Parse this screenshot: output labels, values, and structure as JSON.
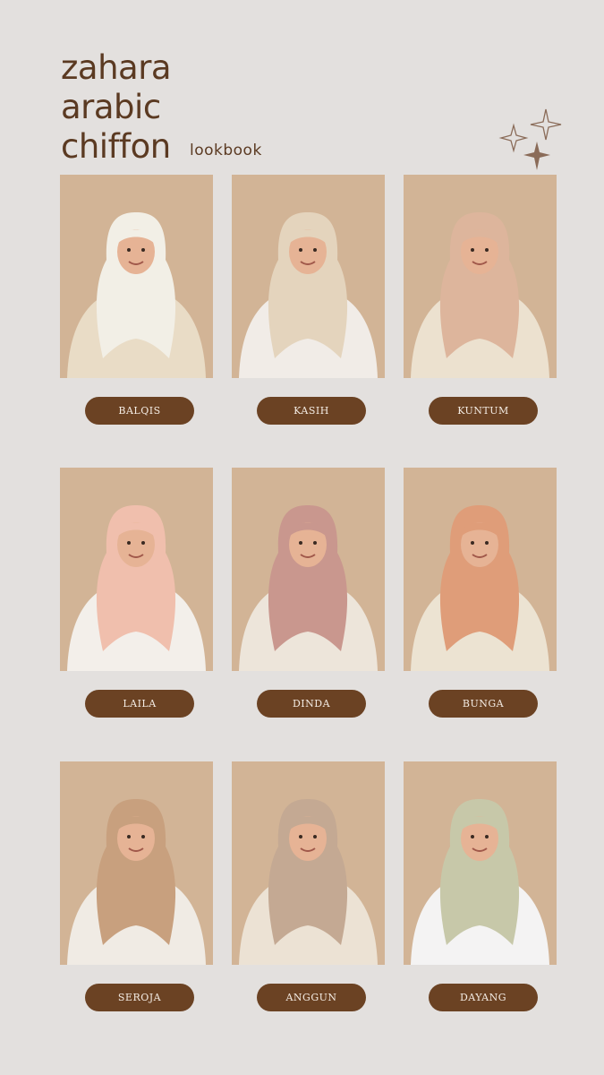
{
  "title_lines": [
    "zahara",
    "arabic",
    "chiffon"
  ],
  "subtitle": "lookbook",
  "looks": [
    {
      "name": "BALQIS",
      "scarf": "#f2efe6",
      "top": "#e9dcc6"
    },
    {
      "name": "KASIH",
      "scarf": "#e4d4bd",
      "top": "#f1ece7"
    },
    {
      "name": "KUNTUM",
      "scarf": "#ddb59c",
      "top": "#ece1cf"
    },
    {
      "name": "LAILA",
      "scarf": "#f0bfad",
      "top": "#f3efea"
    },
    {
      "name": "DINDA",
      "scarf": "#c9978e",
      "top": "#ede5da"
    },
    {
      "name": "BUNGA",
      "scarf": "#df9d79",
      "top": "#ece3d2"
    },
    {
      "name": "SEROJA",
      "scarf": "#c8a07e",
      "top": "#f0ebe4"
    },
    {
      "name": "ANGGUN",
      "scarf": "#c4a993",
      "top": "#ece2d4"
    },
    {
      "name": "DAYANG",
      "scarf": "#c7c8a9",
      "top": "#f4f3f3"
    }
  ],
  "colors": {
    "background": "#e3e0de",
    "card": "#d2b496",
    "pill": "#6b4223",
    "text": "#5b3a22"
  }
}
